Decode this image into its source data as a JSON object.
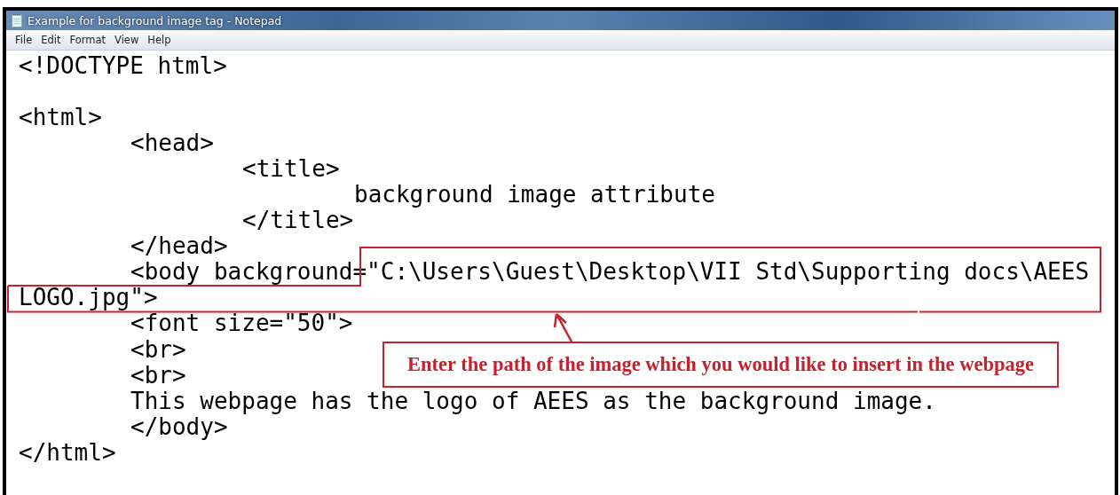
{
  "window": {
    "title": "Example for background image tag - Notepad"
  },
  "menu": [
    "File",
    "Edit",
    "Format",
    "View",
    "Help"
  ],
  "editor": {
    "paragraphs": [
      [
        "<!DOCTYPE html>"
      ],
      [
        "<html>",
        "\t<head>",
        "\t\t<title>",
        "\t\t\tbackground image attribute",
        "\t\t</title>",
        "\t</head>",
        "\t<body background=\"C:\\Users\\Guest\\Desktop\\VII Std\\Supporting docs\\AEES",
        "LOGO.jpg\">",
        "\t<font size=\"50\">",
        "\t<br>",
        "\t<br>",
        "\tThis webpage has the logo of AEES as the background image.",
        "\t</body>",
        "</html>"
      ]
    ]
  },
  "annotation": {
    "label": "Enter the path of the image which you would like to insert in the webpage"
  }
}
